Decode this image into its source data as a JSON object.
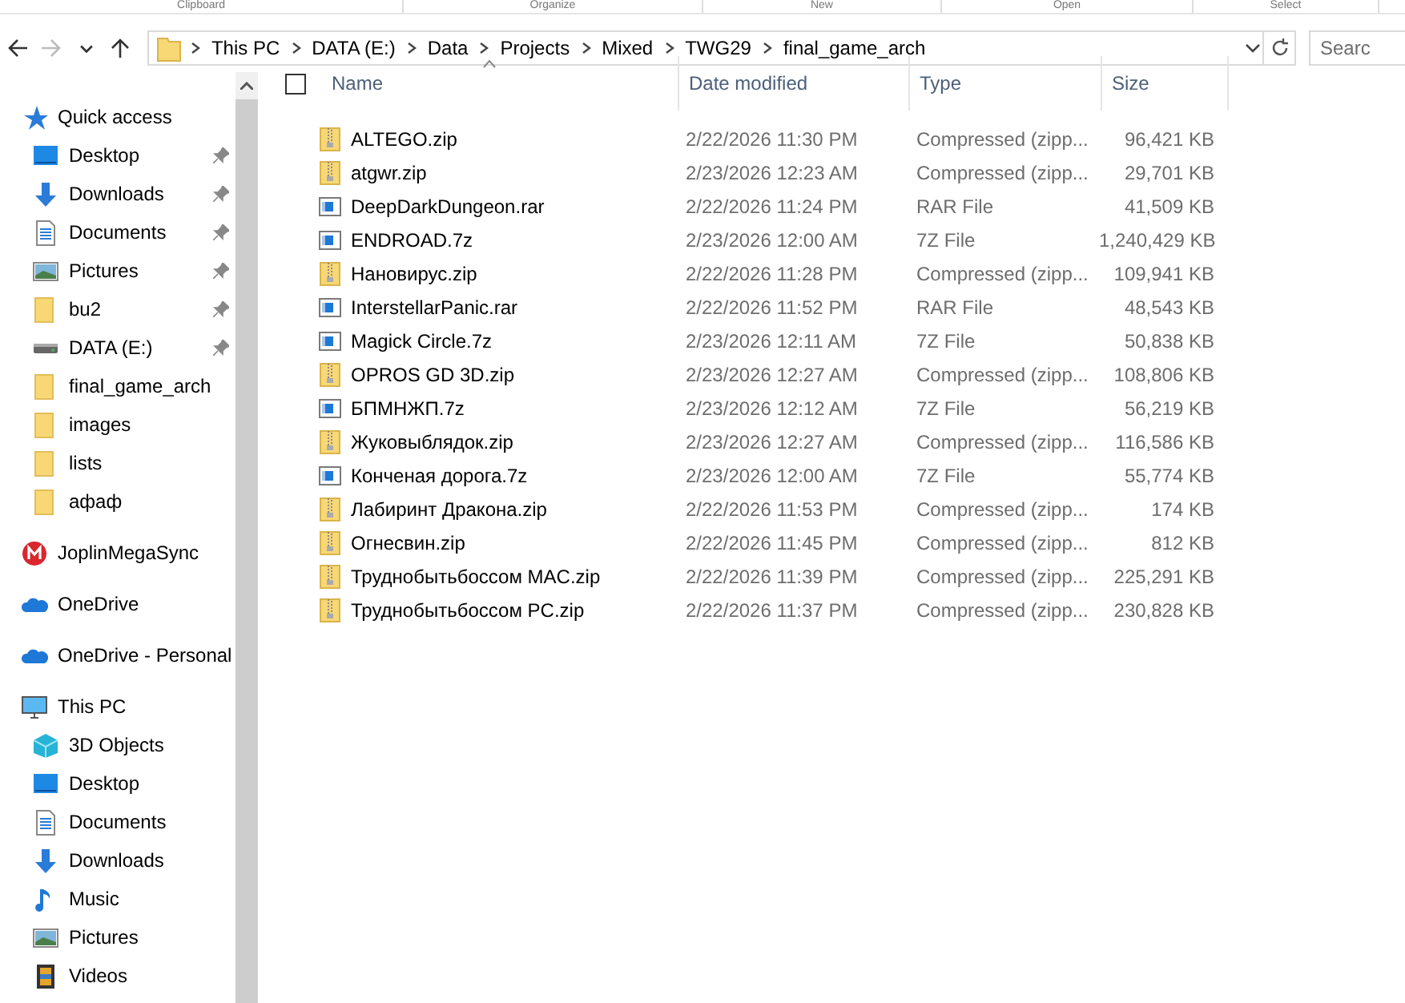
{
  "ribbon": {
    "groups": [
      "Clipboard",
      "Organize",
      "New",
      "Open",
      "Select"
    ]
  },
  "address_bar": {
    "path": [
      "This PC",
      "DATA (E:)",
      "Data",
      "Projects",
      "Mixed",
      "TWG29",
      "final_game_arch"
    ]
  },
  "search": {
    "placeholder": "Searc"
  },
  "sidebar": {
    "items": [
      {
        "label": "Quick access",
        "kind": "star",
        "children": [
          {
            "label": "Desktop",
            "kind": "desktop",
            "pinned": true
          },
          {
            "label": "Downloads",
            "kind": "downloads",
            "pinned": true
          },
          {
            "label": "Documents",
            "kind": "documents",
            "pinned": true
          },
          {
            "label": "Pictures",
            "kind": "pictures",
            "pinned": true
          },
          {
            "label": "bu2",
            "kind": "folder",
            "pinned": true
          },
          {
            "label": "DATA (E:)",
            "kind": "drive",
            "pinned": true
          },
          {
            "label": "final_game_arch",
            "kind": "folder",
            "pinned": false
          },
          {
            "label": "images",
            "kind": "folder",
            "pinned": false
          },
          {
            "label": "lists",
            "kind": "folder",
            "pinned": false
          },
          {
            "label": "афаф",
            "kind": "folder",
            "pinned": false
          }
        ]
      },
      {
        "label": "JoplinMegaSync",
        "kind": "mega"
      },
      {
        "label": "OneDrive",
        "kind": "cloud"
      },
      {
        "label": "OneDrive - Personal",
        "kind": "cloud"
      },
      {
        "label": "This PC",
        "kind": "pc",
        "children": [
          {
            "label": "3D Objects",
            "kind": "cube"
          },
          {
            "label": "Desktop",
            "kind": "desktop"
          },
          {
            "label": "Documents",
            "kind": "documents"
          },
          {
            "label": "Downloads",
            "kind": "downloads"
          },
          {
            "label": "Music",
            "kind": "music"
          },
          {
            "label": "Pictures",
            "kind": "pictures"
          },
          {
            "label": "Videos",
            "kind": "videos"
          }
        ]
      }
    ]
  },
  "table": {
    "select_all": {
      "checked": false
    },
    "columns": [
      "Name",
      "Date modified",
      "Type",
      "Size"
    ],
    "rows": [
      {
        "kind": "zip",
        "name": "ALTEGO.zip",
        "date": "2/22/2026 11:30 PM",
        "type": "Compressed (zipp...",
        "size": "96,421 KB"
      },
      {
        "kind": "zip",
        "name": "atgwr.zip",
        "date": "2/23/2026 12:23 AM",
        "type": "Compressed (zipp...",
        "size": "29,701 KB"
      },
      {
        "kind": "archive",
        "name": "DeepDarkDungeon.rar",
        "date": "2/22/2026 11:24 PM",
        "type": "RAR File",
        "size": "41,509 KB"
      },
      {
        "kind": "archive",
        "name": "ENDROAD.7z",
        "date": "2/23/2026 12:00 AM",
        "type": "7Z File",
        "size": "1,240,429 KB"
      },
      {
        "kind": "zip",
        "name": "Нановирус.zip",
        "date": "2/22/2026 11:28 PM",
        "type": "Compressed (zipp...",
        "size": "109,941 KB"
      },
      {
        "kind": "archive",
        "name": "InterstellarPanic.rar",
        "date": "2/22/2026 11:52 PM",
        "type": "RAR File",
        "size": "48,543 KB"
      },
      {
        "kind": "archive",
        "name": "Magick Circle.7z",
        "date": "2/23/2026 12:11 AM",
        "type": "7Z File",
        "size": "50,838 KB"
      },
      {
        "kind": "zip",
        "name": "OPROS GD 3D.zip",
        "date": "2/23/2026 12:27 AM",
        "type": "Compressed (zipp...",
        "size": "108,806 KB"
      },
      {
        "kind": "archive",
        "name": "БПМНЖП.7z",
        "date": "2/23/2026 12:12 AM",
        "type": "7Z File",
        "size": "56,219 KB"
      },
      {
        "kind": "zip",
        "name": "Жуковыблядок.zip",
        "date": "2/23/2026 12:27 AM",
        "type": "Compressed (zipp...",
        "size": "116,586 KB"
      },
      {
        "kind": "archive",
        "name": "Конченая дорога.7z",
        "date": "2/23/2026 12:00 AM",
        "type": "7Z File",
        "size": "55,774 KB"
      },
      {
        "kind": "zip",
        "name": "Лабиринт Дракона.zip",
        "date": "2/22/2026 11:53 PM",
        "type": "Compressed (zipp...",
        "size": "174 KB"
      },
      {
        "kind": "zip",
        "name": "Огнесвин.zip",
        "date": "2/22/2026 11:45 PM",
        "type": "Compressed (zipp...",
        "size": "812 KB"
      },
      {
        "kind": "zip",
        "name": "Труднобытьбоссом MAC.zip",
        "date": "2/22/2026 11:39 PM",
        "type": "Compressed (zipp...",
        "size": "225,291 KB"
      },
      {
        "kind": "zip",
        "name": "Труднобытьбоссом PC.zip",
        "date": "2/22/2026 11:37 PM",
        "type": "Compressed (zipp...",
        "size": "230,828 KB"
      }
    ]
  }
}
